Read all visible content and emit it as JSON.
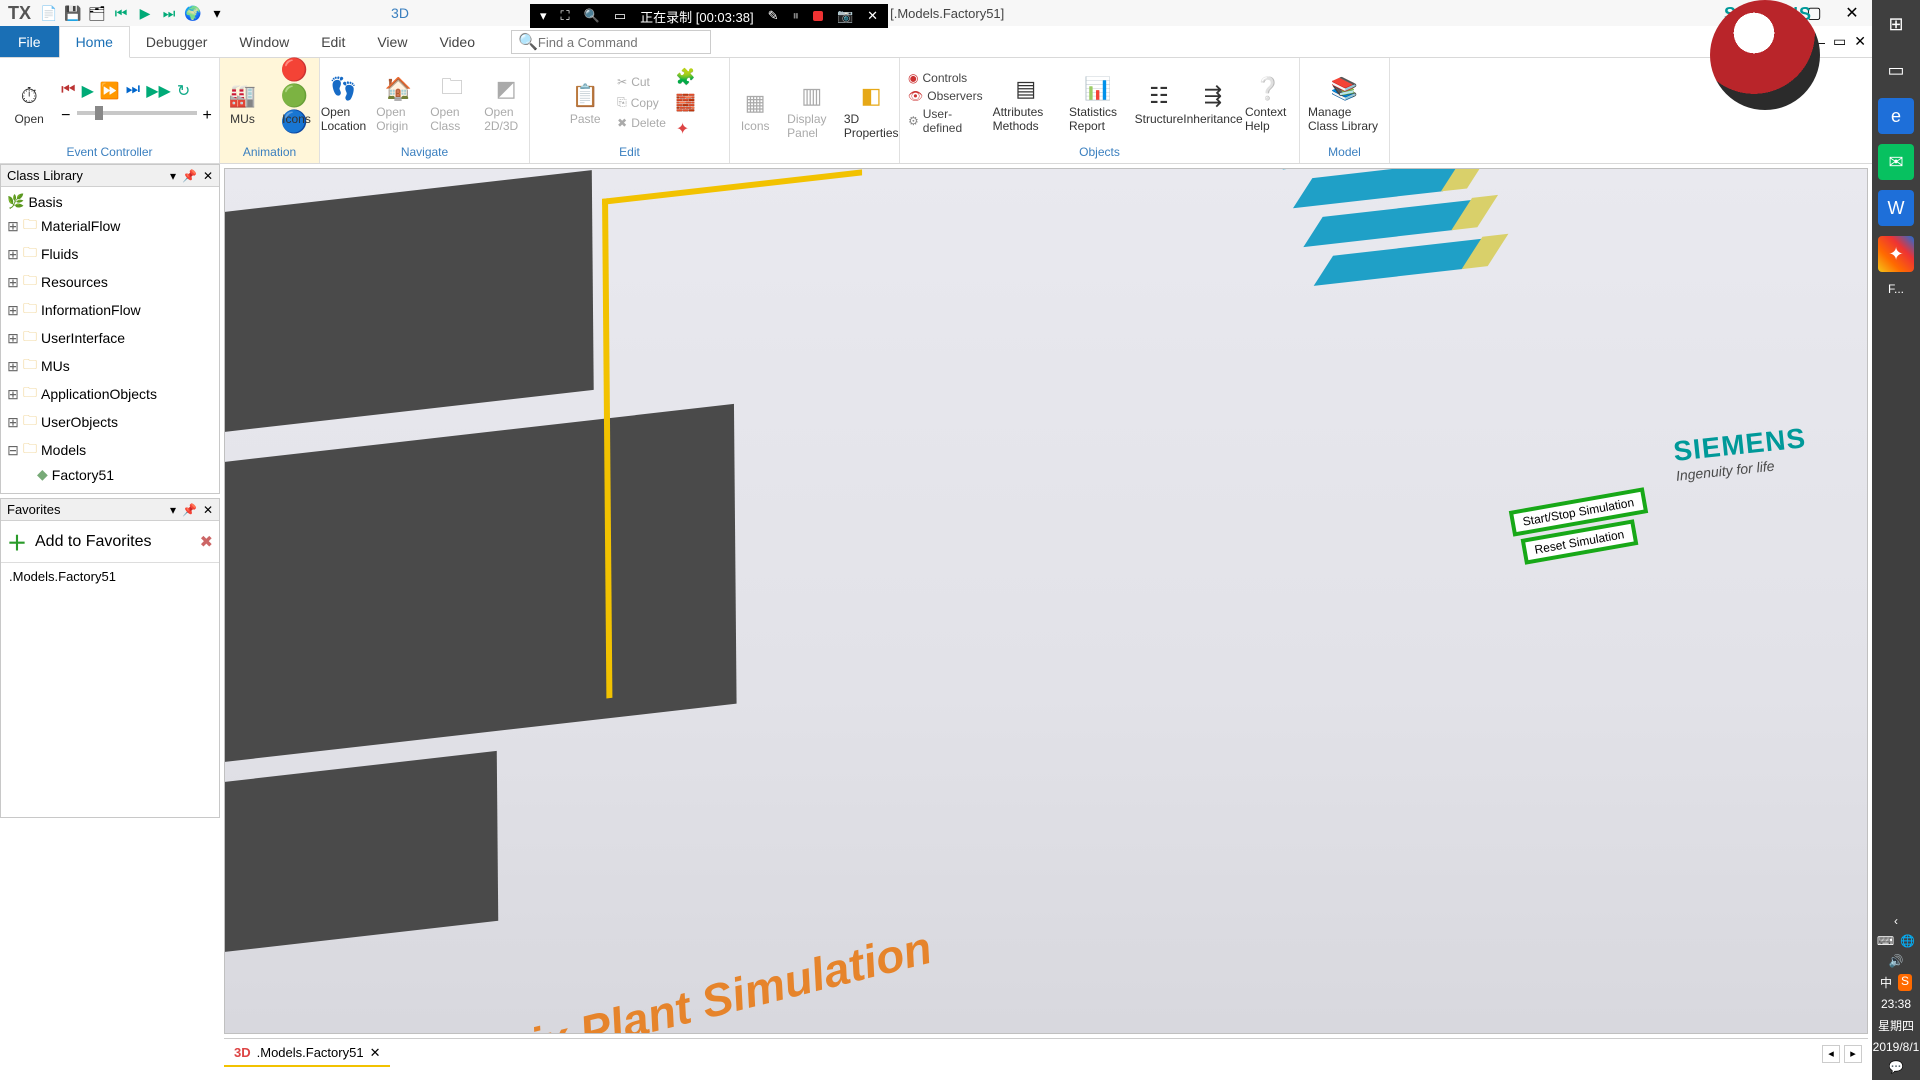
{
  "title": {
    "mode3d": "3D",
    "window": ".1 - [.Models.Factory51]",
    "brand": "SIEMENS"
  },
  "rec": {
    "status": "正在录制 [00:03:38]"
  },
  "menu": {
    "file": "File",
    "tabs": [
      "Home",
      "Debugger",
      "Window",
      "Edit",
      "View",
      "Video"
    ],
    "search_placeholder": "Find a Command"
  },
  "ribbon": {
    "open": "Open",
    "event_controller": "Event Controller",
    "mus": "MUs",
    "icons": "Icons",
    "animation": "Animation",
    "open_location": "Open Location",
    "open_origin": "Open Origin",
    "open_class": "Open Class",
    "open_2d3d": "Open 2D/3D",
    "navigate": "Navigate",
    "paste": "Paste",
    "cut": "Cut",
    "copy": "Copy",
    "delete": "Delete",
    "edit": "Edit",
    "icons2": "Icons",
    "display_panel": "Display Panel",
    "props3d": "3D Properties",
    "controls": "Controls",
    "observers": "Observers",
    "userdef": "User-defined",
    "attr_methods": "Attributes Methods",
    "stats_report": "Statistics Report",
    "structure": "Structure",
    "inheritance": "Inheritance",
    "context_help": "Context Help",
    "objects": "Objects",
    "manage_cl": "Manage Class Library",
    "model": "Model"
  },
  "classlib": {
    "title": "Class Library",
    "root": "Basis",
    "nodes": [
      "MaterialFlow",
      "Fluids",
      "Resources",
      "InformationFlow",
      "UserInterface",
      "MUs",
      "ApplicationObjects",
      "UserObjects",
      "Models"
    ],
    "model_child": "Factory51"
  },
  "favorites": {
    "title": "Favorites",
    "add": "Add to Favorites",
    "item": ".Models.Factory51"
  },
  "view": {
    "start_stop": "Start/Stop Simulation",
    "reset": "Reset Simulation",
    "siemens": "SIEMENS",
    "siemens_tag": "Ingenuity for life",
    "ps": "ix Plant Simulation"
  },
  "doctab": {
    "label": ".Models.Factory51"
  },
  "systray": {
    "ime": "中",
    "time": "23:38",
    "day": "星期四",
    "date": "2019/8/1",
    "f": "F..."
  }
}
